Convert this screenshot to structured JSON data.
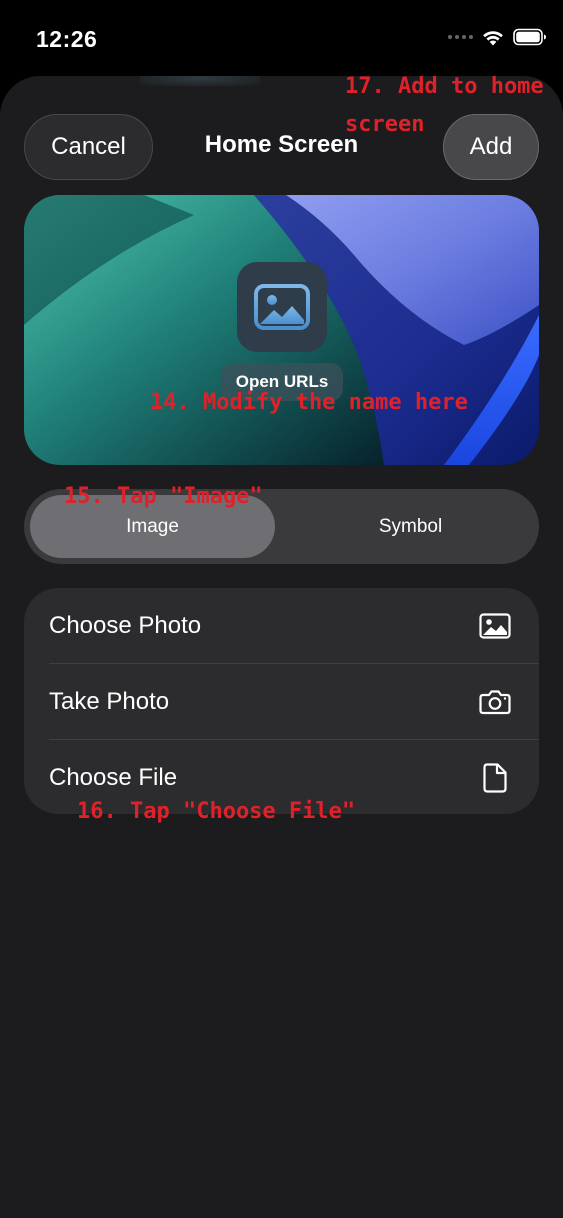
{
  "status_bar": {
    "time": "12:26",
    "icons": [
      "signal-icon",
      "wifi-icon",
      "battery-icon"
    ]
  },
  "header": {
    "cancel_label": "Cancel",
    "title": "Home Screen",
    "add_label": "Add"
  },
  "preview": {
    "app_name": "Open URLs",
    "icon": "photo-icon"
  },
  "segmented": {
    "options": [
      "Image",
      "Symbol"
    ],
    "selected": "Image"
  },
  "options": [
    {
      "label": "Choose Photo",
      "icon": "photo-icon"
    },
    {
      "label": "Take Photo",
      "icon": "camera-icon"
    },
    {
      "label": "Choose File",
      "icon": "document-icon"
    }
  ],
  "annotations": {
    "add_step_line1": "17. Add to home",
    "add_step_line2": "screen",
    "name_step": "14. Modify the name here",
    "image_step": "15. Tap \"Image\"",
    "file_step": "16. Tap \"Choose File\""
  },
  "colors": {
    "background": "#000000",
    "sheet": "#1c1c1e",
    "card": "#2c2c2e",
    "segment_selected": "#6e6e73",
    "annotation": "#e0212a"
  }
}
